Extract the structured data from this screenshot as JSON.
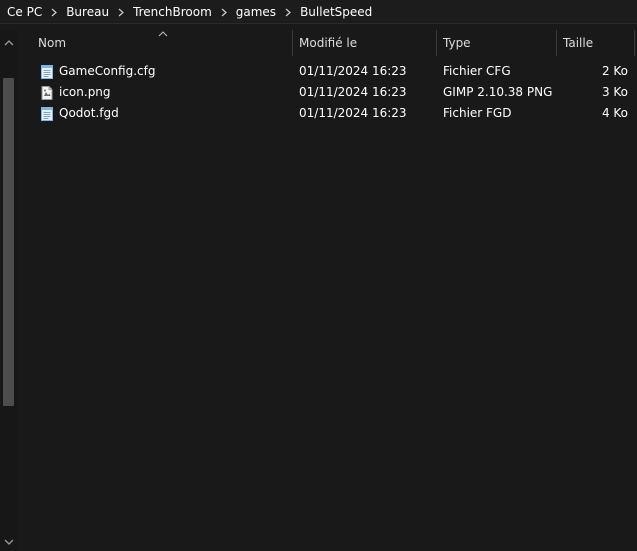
{
  "breadcrumb": {
    "items": [
      "Ce PC",
      "Bureau",
      "TrenchBroom",
      "games",
      "BulletSpeed"
    ]
  },
  "columns": {
    "name": "Nom",
    "modified": "Modifié le",
    "type": "Type",
    "size": "Taille"
  },
  "files": [
    {
      "name": "GameConfig.cfg",
      "modified": "01/11/2024 16:23",
      "type": "Fichier CFG",
      "size": "2 Ko",
      "icon": "text-file-icon"
    },
    {
      "name": "icon.png",
      "modified": "01/11/2024 16:23",
      "type": "GIMP 2.10.38 PNG",
      "size": "3 Ko",
      "icon": "image-file-icon"
    },
    {
      "name": "Qodot.fgd",
      "modified": "01/11/2024 16:23",
      "type": "Fichier FGD",
      "size": "4 Ko",
      "icon": "text-file-icon"
    }
  ],
  "colors": {
    "background": "#191919",
    "text": "#ffffff",
    "scrollbar_thumb": "#4d4d4d",
    "icon_blue": "#7fb6e8"
  }
}
